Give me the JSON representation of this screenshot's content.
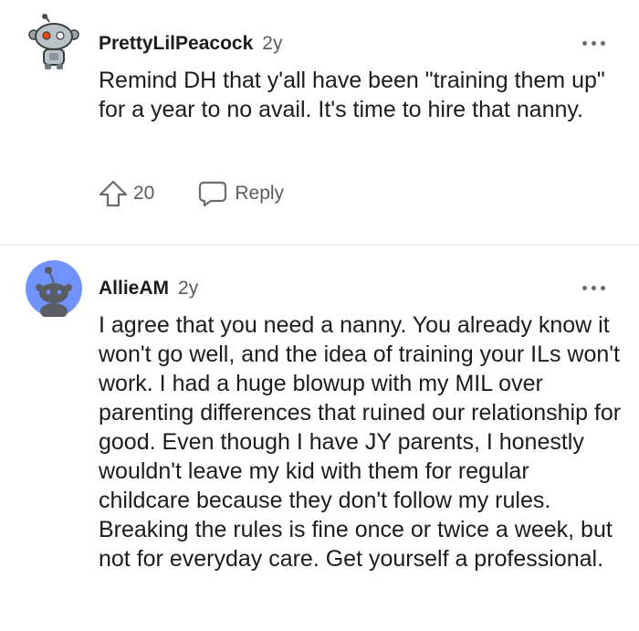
{
  "comments": [
    {
      "username": "PrettyLilPeacock",
      "age": "2y",
      "avatar_icon": "snoo-robot-avatar-icon",
      "text": "Remind DH that y'all have been \"training them up\" for a year to no avail. It's time to hire that nanny.",
      "upvotes": "20",
      "reply_label": "Reply"
    },
    {
      "username": "AllieAM",
      "age": "2y",
      "avatar_icon": "snoo-default-avatar-icon",
      "text": "I agree that you need a nanny. You already know it won't go well, and the idea of training your ILs won't work. I had a huge blowup with my MIL over parenting differences that ruined our relationship for good. Even though I have JY parents, I honestly wouldn't leave my kid with them for regular childcare because they don't follow my rules. Breaking the rules is fine once or twice a week, but not for everyday care. Get yourself a professional."
    }
  ],
  "colors": {
    "text": "#1c1c1c",
    "muted": "#5c5c5c",
    "divider": "#ececec",
    "avatar_blue": "#7193ff"
  },
  "icons": [
    "more-options-icon",
    "upvote-icon",
    "reply-bubble-icon"
  ]
}
